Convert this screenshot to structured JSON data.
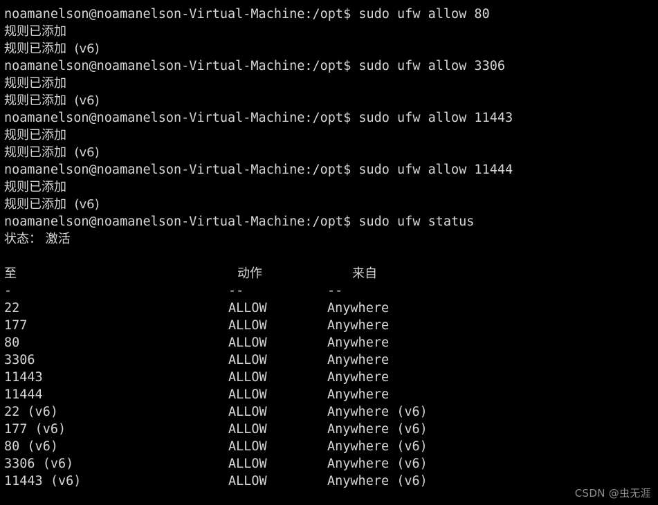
{
  "terminal": {
    "colors": {
      "background": "#000000",
      "foreground": "#d6d6d6",
      "watermark": "#8f8f8f"
    },
    "prompt": "noamanelson@noamanelson-Virtual-Machine:/opt$",
    "commands": {
      "allow_80": "sudo ufw allow 80",
      "allow_3306": "sudo ufw allow 3306",
      "allow_11443": "sudo ufw allow 11443",
      "allow_11444": "sudo ufw allow 11444",
      "status": "sudo ufw status"
    },
    "output": {
      "rule_added": "规则已添加",
      "rule_added_v6": "规则已添加  (v6)",
      "status_line": "状态： 激活"
    },
    "lines": {
      "l01_prompt": "noamanelson@noamanelson-Virtual-Machine:/opt$ ",
      "l01_cmd": "sudo ufw allow 80",
      "l02": "规则已添加",
      "l03": "规则已添加  (v6)",
      "l04_prompt": "noamanelson@noamanelson-Virtual-Machine:/opt$ ",
      "l04_cmd": "sudo ufw allow 3306",
      "l05": "规则已添加",
      "l06": "规则已添加  (v6)",
      "l07_prompt": "noamanelson@noamanelson-Virtual-Machine:/opt$ ",
      "l07_cmd": "sudo ufw allow 11443",
      "l08": "规则已添加",
      "l09": "规则已添加  (v6)",
      "l10_prompt": "noamanelson@noamanelson-Virtual-Machine:/opt$ ",
      "l10_cmd": "sudo ufw allow 11444",
      "l11": "规则已添加",
      "l12": "规则已添加  (v6)",
      "l13_prompt": "noamanelson@noamanelson-Virtual-Machine:/opt$ ",
      "l13_cmd": "sudo ufw status",
      "l14": "状态： 激活"
    },
    "status_table": {
      "headers": {
        "to": "至",
        "action": "动作",
        "from": "来自"
      },
      "separators": {
        "to": "-",
        "action": "--",
        "from": "--"
      },
      "rows": [
        {
          "to": "22",
          "action": "ALLOW",
          "from": "Anywhere"
        },
        {
          "to": "177",
          "action": "ALLOW",
          "from": "Anywhere"
        },
        {
          "to": "80",
          "action": "ALLOW",
          "from": "Anywhere"
        },
        {
          "to": "3306",
          "action": "ALLOW",
          "from": "Anywhere"
        },
        {
          "to": "11443",
          "action": "ALLOW",
          "from": "Anywhere"
        },
        {
          "to": "11444",
          "action": "ALLOW",
          "from": "Anywhere"
        },
        {
          "to": "22 (v6)",
          "action": "ALLOW",
          "from": "Anywhere (v6)"
        },
        {
          "to": "177 (v6)",
          "action": "ALLOW",
          "from": "Anywhere (v6)"
        },
        {
          "to": "80 (v6)",
          "action": "ALLOW",
          "from": "Anywhere (v6)"
        },
        {
          "to": "3306 (v6)",
          "action": "ALLOW",
          "from": "Anywhere (v6)"
        },
        {
          "to": "11443 (v6)",
          "action": "ALLOW",
          "from": "Anywhere (v6)"
        }
      ]
    }
  },
  "watermark": {
    "text": "CSDN @虫无涯"
  }
}
